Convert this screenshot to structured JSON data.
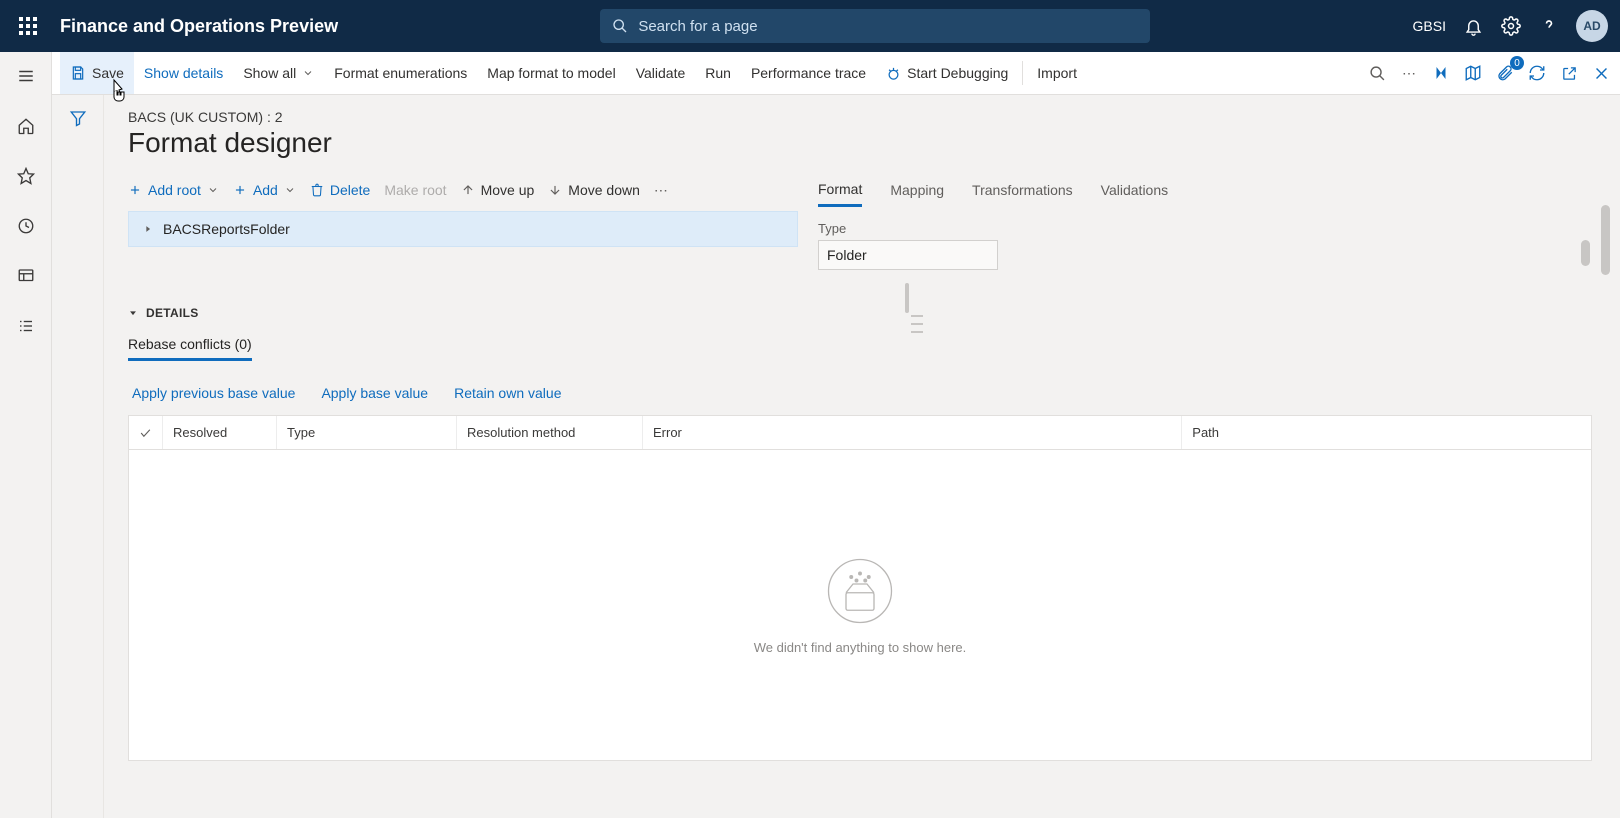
{
  "app": {
    "title": "Finance and Operations Preview"
  },
  "search": {
    "placeholder": "Search for a page"
  },
  "user": {
    "env": "GBSI",
    "initials": "AD"
  },
  "cmdbar": {
    "save": "Save",
    "showDetails": "Show details",
    "showAll": "Show all",
    "formatEnum": "Format enumerations",
    "mapFormat": "Map format to model",
    "validate": "Validate",
    "run": "Run",
    "perfTrace": "Performance trace",
    "startDebug": "Start Debugging",
    "import": "Import",
    "badge": "0"
  },
  "page": {
    "breadcrumb": "BACS (UK CUSTOM) : 2",
    "title": "Format designer"
  },
  "treeToolbar": {
    "addRoot": "Add root",
    "add": "Add",
    "delete": "Delete",
    "makeRoot": "Make root",
    "moveUp": "Move up",
    "moveDown": "Move down"
  },
  "tree": {
    "node0": "BACSReportsFolder"
  },
  "propTabs": {
    "format": "Format",
    "mapping": "Mapping",
    "transformations": "Transformations",
    "validations": "Validations"
  },
  "prop": {
    "typeLabel": "Type",
    "typeValue": "Folder"
  },
  "details": {
    "header": "DETAILS",
    "subtab": "Rebase conflicts (0)"
  },
  "links": {
    "applyPrev": "Apply previous base value",
    "applyBase": "Apply base value",
    "retainOwn": "Retain own value"
  },
  "grid": {
    "resolved": "Resolved",
    "type": "Type",
    "resolution": "Resolution method",
    "error": "Error",
    "path": "Path",
    "empty": "We didn't find anything to show here."
  }
}
